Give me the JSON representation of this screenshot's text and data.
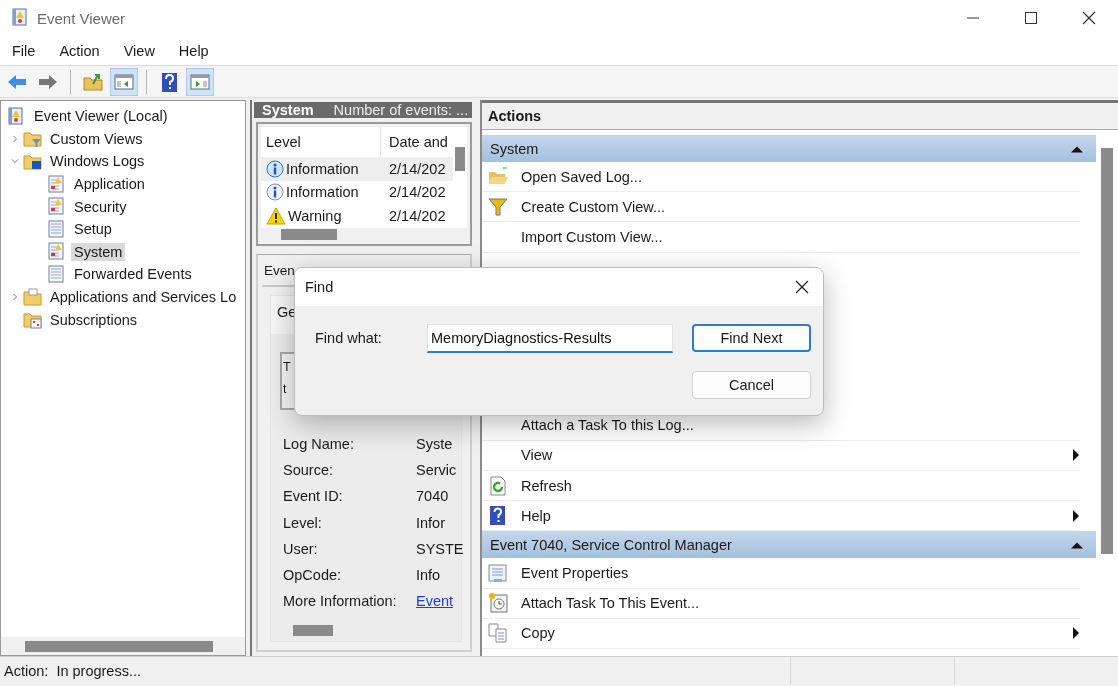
{
  "window": {
    "title": "Event Viewer"
  },
  "menu": [
    "File",
    "Action",
    "View",
    "Help"
  ],
  "toolbar": [
    [
      {
        "kind": "back",
        "pressed": false
      },
      {
        "kind": "forward",
        "pressed": false
      }
    ],
    [
      {
        "kind": "up",
        "pressed": false
      },
      {
        "kind": "tree",
        "pressed": true
      }
    ],
    [
      {
        "kind": "help",
        "pressed": false
      },
      {
        "kind": "actions",
        "pressed": true
      }
    ]
  ],
  "tree": {
    "label": "Event Viewer (Local)",
    "kind": "root",
    "selected": false,
    "children": [
      {
        "label": "Custom Views",
        "kind": "filter-folder",
        "selected": false,
        "expanded": false
      },
      {
        "label": "Windows Logs",
        "kind": "windows-folder",
        "selected": false,
        "expanded": true,
        "children": [
          {
            "label": "Application",
            "kind": "log",
            "selected": false
          },
          {
            "label": "Security",
            "kind": "log",
            "selected": false
          },
          {
            "label": "Setup",
            "kind": "page",
            "selected": false
          },
          {
            "label": "System",
            "kind": "log",
            "selected": true
          },
          {
            "label": "Forwarded Events",
            "kind": "page",
            "selected": false
          }
        ]
      },
      {
        "label": "Applications and Services Lo",
        "kind": "folder",
        "selected": false,
        "expanded": false
      },
      {
        "label": "Subscriptions",
        "kind": "subscriptions",
        "selected": false
      }
    ]
  },
  "log_view": {
    "title": "System",
    "summary": "Number of events: ...",
    "columns": [
      "Level",
      "Date and"
    ],
    "rows": [
      {
        "kind": "information",
        "level": "Information",
        "date": "2/14/202",
        "selected": true
      },
      {
        "kind": "information",
        "level": "Information",
        "date": "2/14/202",
        "selected": false
      },
      {
        "kind": "warning",
        "level": "Warning",
        "date": "2/14/202",
        "selected": false
      }
    ]
  },
  "event_details": {
    "tab": "Even",
    "general_tab": "Ge",
    "description": [
      "T",
      "t"
    ],
    "fields": [
      {
        "label": "Log Name:",
        "value": "Syste",
        "kind": "text"
      },
      {
        "label": "Source:",
        "value": "Servic",
        "kind": "text"
      },
      {
        "label": "Event ID:",
        "value": "7040",
        "kind": "text"
      },
      {
        "label": "Level:",
        "value": "Infor",
        "kind": "text"
      },
      {
        "label": "User:",
        "value": "SYSTE",
        "kind": "text"
      },
      {
        "label": "OpCode:",
        "value": "Info",
        "kind": "text"
      },
      {
        "label": "More Information:",
        "value": "Event",
        "kind": "link"
      }
    ]
  },
  "actions": {
    "title": "Actions",
    "sections": [
      {
        "title": "System",
        "expanded": true,
        "items": [
          {
            "label": "Open Saved Log...",
            "kind": "open-folder",
            "submenu": false
          },
          {
            "label": "Create Custom View...",
            "kind": "filter",
            "submenu": false
          },
          {
            "label": "Import Custom View...",
            "kind": "plain",
            "submenu": false
          },
          {
            "label": "Attach a Task To this Log...",
            "kind": "plain",
            "submenu": false
          },
          {
            "label": "View",
            "kind": "plain",
            "submenu": true
          },
          {
            "label": "Refresh",
            "kind": "refresh",
            "submenu": false
          },
          {
            "label": "Help",
            "kind": "help",
            "submenu": true
          }
        ]
      },
      {
        "title": "Event 7040, Service Control Manager",
        "expanded": true,
        "items": [
          {
            "label": "Event Properties",
            "kind": "properties",
            "submenu": false
          },
          {
            "label": "Attach Task To This Event...",
            "kind": "task",
            "submenu": false
          },
          {
            "label": "Copy",
            "kind": "copy",
            "submenu": true
          }
        ]
      }
    ]
  },
  "find_dialog": {
    "title": "Find",
    "label": "Find what:",
    "value": "MemoryDiagnostics-Results",
    "buttons": [
      {
        "label": "Find Next",
        "default": true
      },
      {
        "label": "Cancel",
        "default": false
      }
    ]
  },
  "status_bar": {
    "text": "Action:  In progress..."
  }
}
